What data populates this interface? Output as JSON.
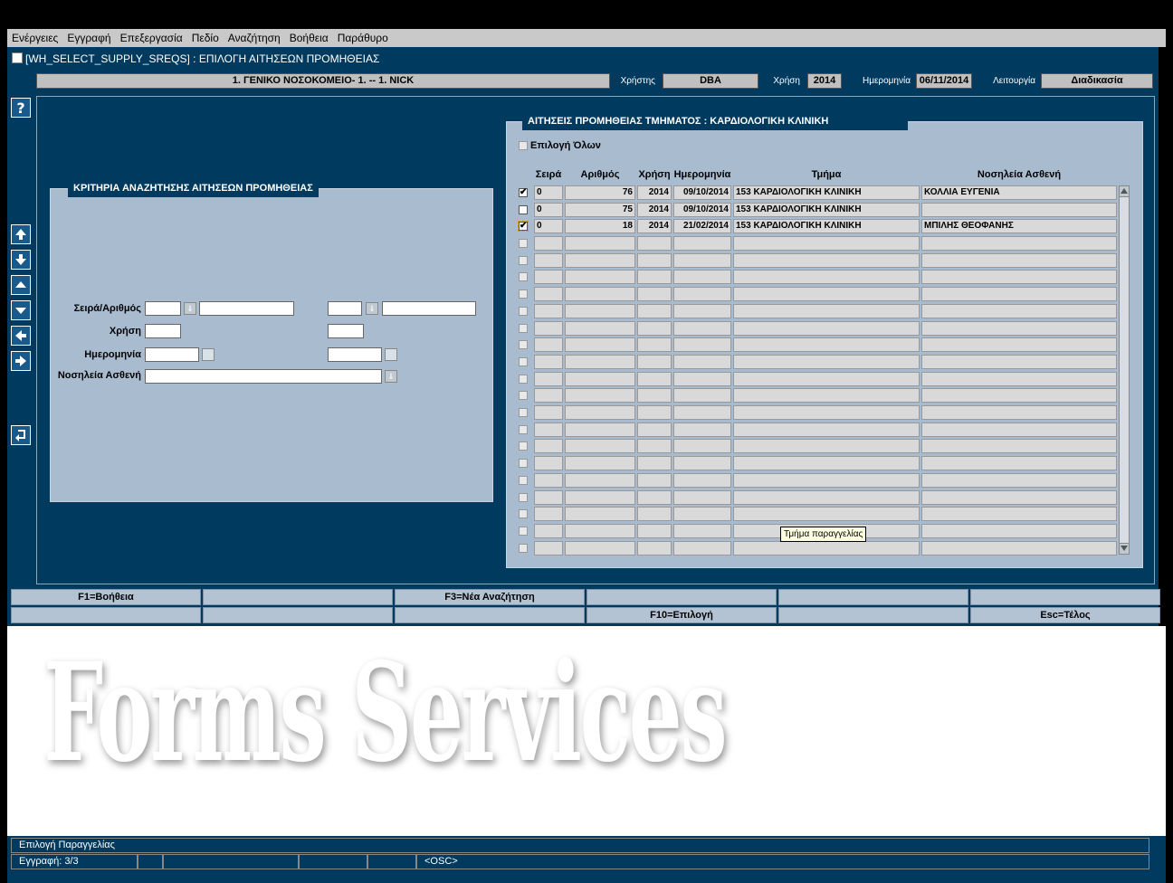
{
  "menu": [
    "Ενέργειες",
    "Εγγραφή",
    "Επεξεργασία",
    "Πεδίο",
    "Αναζήτηση",
    "Βοήθεια",
    "Παράθυρο"
  ],
  "window": {
    "title": "[WH_SELECT_SUPPLY_SREQS]  :  ΕΠΙΛΟΓΗ ΑΙΤΗΣΕΩΝ ΠΡΟΜΗΘΕΙΑΣ"
  },
  "header": {
    "org": "1. ΓΕΝΙΚΟ ΝΟΣΟΚΟΜΕΙΟ- 1. -- 1. NICK",
    "user_label": "Χρήστης",
    "user": "DBA",
    "year_label": "Χρήση",
    "year": "2014",
    "date_label": "Ημερομηνία",
    "date": "06/11/2014",
    "function_label": "Λειτουργία",
    "function": "Διαδικασία"
  },
  "criteria": {
    "title": "ΚΡΙΤΗΡΙΑ ΑΝΑΖΗΤΗΣΗΣ ΑΙΤΗΣΕΩΝ ΠΡΟΜΗΘΕΙΑΣ",
    "series_label": "Σειρά/Αριθμός",
    "year_label": "Χρήση",
    "date_label": "Ημερομηνία",
    "patient_label": "Νοσηλεία Ασθενή"
  },
  "requests": {
    "title": "ΑΙΤΗΣΕΙΣ ΠΡΟΜΗΘΕΙΑΣ ΤΜΗΜΑΤΟΣ : ΚΑΡΔΙΟΛΟΓΙΚΗ ΚΛΙΝΙΚΗ",
    "select_all": "Επιλογή Όλων",
    "columns": [
      "Σειρά",
      "Αριθμός",
      "Χρήση",
      "Ημερομηνία",
      "Τμήμα",
      "Νοσηλεία Ασθενή"
    ],
    "rows": [
      {
        "checked": "✔",
        "seira": "0",
        "arithmos": "76",
        "xrisi": "2014",
        "date": "09/10/2014",
        "tmima": "153 ΚΑΡΔΙΟΛΟΓΙΚΗ ΚΛΙΝΙΚΗ",
        "patient": "ΚΟΛΛΙΑ ΕΥΓΕΝΙΑ"
      },
      {
        "checked": "",
        "seira": "0",
        "arithmos": "75",
        "xrisi": "2014",
        "date": "09/10/2014",
        "tmima": "153 ΚΑΡΔΙΟΛΟΓΙΚΗ ΚΛΙΝΙΚΗ",
        "patient": ""
      },
      {
        "checked": "✔",
        "seira": "0",
        "arithmos": "18",
        "xrisi": "2014",
        "date": "21/02/2014",
        "tmima": "153 ΚΑΡΔΙΟΛΟΓΙΚΗ ΚΛΙΝΙΚΗ",
        "patient": "ΜΠΙΛΗΣ ΘΕΟΦΑΝΗΣ"
      }
    ],
    "tooltip": "Τμήμα παραγγελίας"
  },
  "fkeys": [
    "F1=Βοήθεια",
    "",
    "F3=Νέα Αναζήτηση",
    "",
    "",
    "",
    "",
    "",
    "",
    "F10=Επιλογή",
    "",
    "Esc=Τέλος"
  ],
  "watermark": "Forms Services",
  "status": {
    "message": "Επιλογή Παραγγελίας",
    "record": "Εγγραφή: 3/3",
    "osc": "<OSC>"
  },
  "icons": {
    "help": "help-icon",
    "nav": [
      "first-record-icon",
      "last-record-icon",
      "previous-record-icon",
      "next-record-icon",
      "previous-block-icon",
      "next-block-icon",
      "exit-icon"
    ]
  }
}
